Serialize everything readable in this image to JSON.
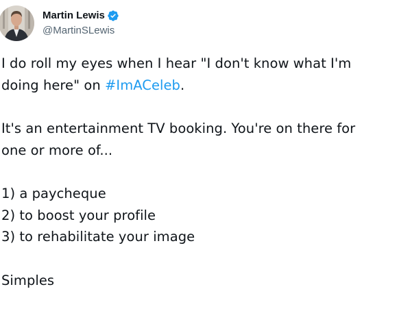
{
  "author": {
    "display_name": "Martin Lewis",
    "handle": "@MartinSLewis",
    "verified_icon": "verified-badge-icon",
    "verified_color": "#1d9bf0"
  },
  "tweet": {
    "p1_line1": "I do roll my eyes when I hear \"I don't know what I'm",
    "p1_line2_pre": "doing here\" on ",
    "hashtag": "#ImACeleb",
    "p1_line2_post": ".",
    "p2_line1": "It's an entertainment TV booking. You're on there for",
    "p2_line2": "one or more of...",
    "list": [
      "1) a paycheque",
      "2) to boost your profile",
      "3) to rehabilitate your image"
    ],
    "closing": "Simples"
  },
  "colors": {
    "text": "#0f1419",
    "secondary": "#536471",
    "link": "#1d9bf0"
  }
}
